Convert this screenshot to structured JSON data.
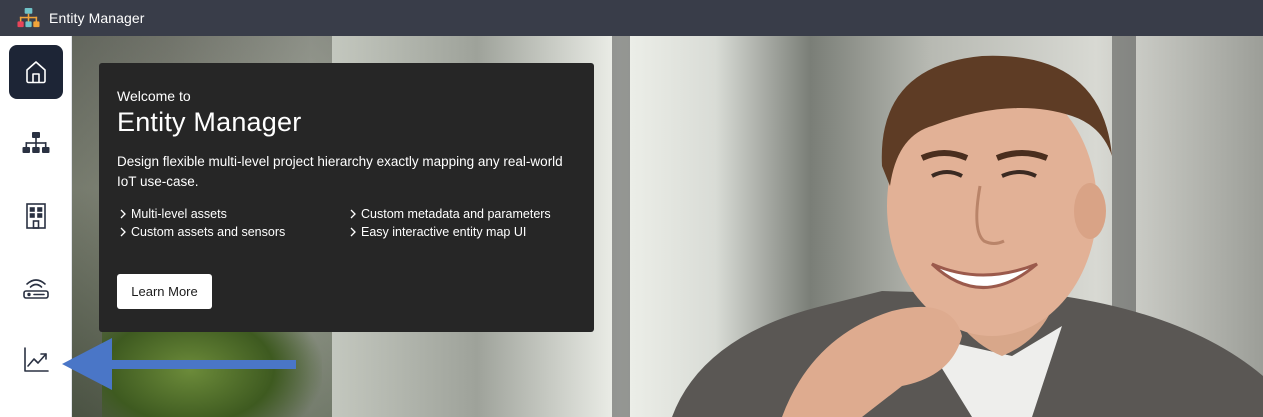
{
  "header": {
    "app_title": "Entity Manager",
    "logo_icon": "hierarchy-logo-icon"
  },
  "sidebar": {
    "items": [
      {
        "name": "home",
        "icon": "home-icon",
        "active": true
      },
      {
        "name": "hierarchy",
        "icon": "org-chart-icon",
        "active": false
      },
      {
        "name": "building",
        "icon": "building-icon",
        "active": false
      },
      {
        "name": "gateway",
        "icon": "router-icon",
        "active": false
      },
      {
        "name": "analytics",
        "icon": "trending-chart-icon",
        "active": false
      }
    ]
  },
  "welcome_card": {
    "welcome_text": "Welcome to",
    "app_name": "Entity Manager",
    "description": "Design flexible multi-level project hierarchy exactly mapping any real-world IoT use-case.",
    "features": [
      "Multi-level assets",
      "Custom metadata and parameters",
      "Custom assets and sensors",
      "Easy interactive entity map UI"
    ],
    "button_label": "Learn More"
  },
  "colors": {
    "topbar": "#393d49",
    "active_nav": "#1d2536",
    "card_bg": "#262626",
    "annotation_arrow": "#4a76c7"
  }
}
